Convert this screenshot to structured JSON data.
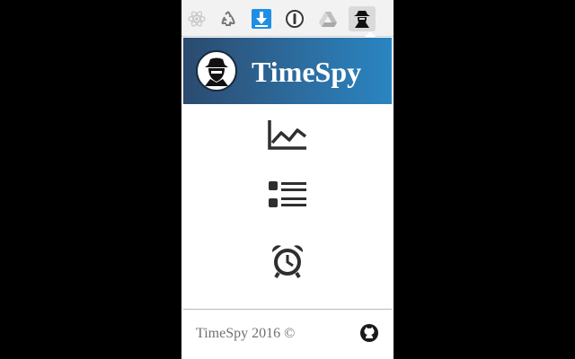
{
  "toolbar": {
    "icons": [
      {
        "name": "react-icon"
      },
      {
        "name": "recycle-icon"
      },
      {
        "name": "download-icon"
      },
      {
        "name": "password-manager-icon"
      },
      {
        "name": "google-drive-icon"
      },
      {
        "name": "timespy-extension-icon",
        "active": true
      }
    ]
  },
  "header": {
    "title": "TimeSpy",
    "gradient_start": "#2b4a6e",
    "gradient_end": "#2a85c2"
  },
  "nav": [
    {
      "name": "chart-icon"
    },
    {
      "name": "list-icon"
    },
    {
      "name": "alarm-clock-icon"
    }
  ],
  "footer": {
    "copyright": "TimeSpy 2016 ©",
    "github_icon": "github-icon"
  }
}
